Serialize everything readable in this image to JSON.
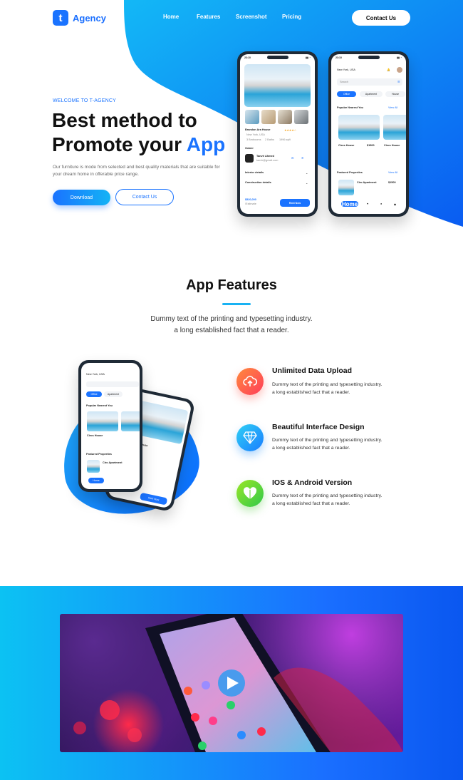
{
  "brand": {
    "logo_letter": "t",
    "name": "Agency"
  },
  "nav": {
    "items": [
      "Home",
      "Features",
      "Screenshot",
      "Pricing"
    ],
    "contact_label": "Contact Us"
  },
  "hero": {
    "kicker": "WELCOME TO T-AGENCY",
    "title_line1": "Best method to",
    "title_line2_a": "Promote your ",
    "title_line2_b": "App",
    "description": "Our furniture is mode from selected and best quality materials that are suitable for your dream home in offerable price range.",
    "download_label": "Download",
    "contact_label": "Contact Us"
  },
  "phone_detail": {
    "time": "23:10",
    "house_name": "Brandon Ara House",
    "location": "New York, USA",
    "stats": [
      "3 Bedrooms",
      "2 Baths",
      "1996 sqft"
    ],
    "owner_label": "Owner",
    "owner_name": "Tanvir Ahmed",
    "owner_email": "tanvir@gmail.com",
    "interior": "Interior details",
    "construction": "Construction details",
    "price": "$520,000",
    "price_sub": "/Estimate",
    "cta": "Rent Now"
  },
  "phone_list": {
    "time": "23:10",
    "location": "New York, USA",
    "search_placeholder": "Search",
    "tabs": [
      "Office",
      "Apartment",
      "House"
    ],
    "popular": "Popular Nearest You",
    "view_all": "View All",
    "card1_name": "Ciros House",
    "card1_price": "$1500",
    "card2_name": "Ciros House",
    "featured": "Featured Properties",
    "featured_name": "Ciro Apartment",
    "featured_price": "$1500",
    "home_tab": "Home"
  },
  "features": {
    "title": "App Features",
    "description_line1": "Dummy text of the printing and typesetting industry.",
    "description_line2": "a long established fact that a reader.",
    "items": [
      {
        "title": "Unlimited Data Upload",
        "line1": "Dummy text of the printing and typesetting industry.",
        "line2": "a long established fact that a reader.",
        "color": "#ff5a3c"
      },
      {
        "title": "Beautiful Interface Design",
        "line1": "Dummy text of the printing and typesetting industry.",
        "line2": "a long established fact that a reader.",
        "color": "#1ea6f6"
      },
      {
        "title": "IOS & Android Version",
        "line1": "Dummy text of the printing and typesetting industry.",
        "line2": "a long established fact that a reader.",
        "color": "#5ed62a"
      }
    ]
  },
  "colors": {
    "accent": "#1a73ff",
    "cyan": "#13b3f5"
  },
  "icons": [
    "cloud-upload-icon",
    "diamond-icon",
    "heart-icon",
    "play-icon"
  ]
}
